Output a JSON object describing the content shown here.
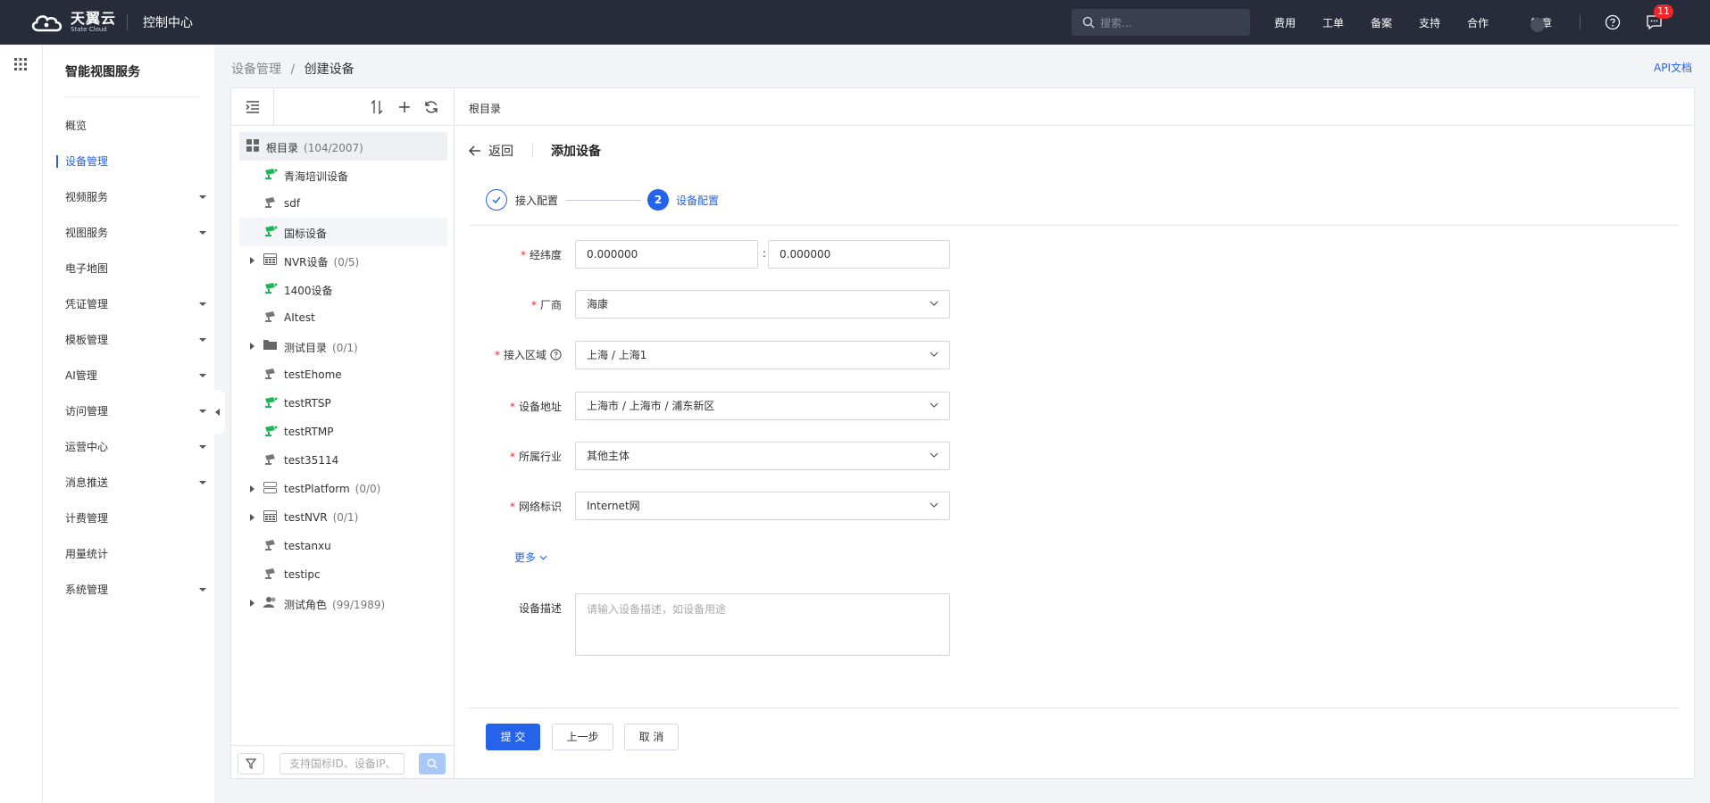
{
  "topbar": {
    "brand_cn": "天翼云",
    "brand_en": "State Cloud",
    "console": "控制中心",
    "search_placeholder": "搜索...",
    "nav": [
      "费用",
      "工单",
      "备案",
      "支持",
      "合作"
    ],
    "user_label": "简章",
    "notification_count": "11"
  },
  "sidebar": {
    "title": "智能视图服务",
    "items": [
      {
        "label": "概览",
        "dropdown": false
      },
      {
        "label": "设备管理",
        "dropdown": false,
        "active": true
      },
      {
        "label": "视频服务",
        "dropdown": true
      },
      {
        "label": "视图服务",
        "dropdown": true
      },
      {
        "label": "电子地图",
        "dropdown": false
      },
      {
        "label": "凭证管理",
        "dropdown": true
      },
      {
        "label": "模板管理",
        "dropdown": true
      },
      {
        "label": "AI管理",
        "dropdown": true
      },
      {
        "label": "访问管理",
        "dropdown": true
      },
      {
        "label": "运营中心",
        "dropdown": true
      },
      {
        "label": "消息推送",
        "dropdown": true
      },
      {
        "label": "计费管理",
        "dropdown": false
      },
      {
        "label": "用量统计",
        "dropdown": false
      },
      {
        "label": "系统管理",
        "dropdown": true
      }
    ]
  },
  "breadcrumb": {
    "parent": "设备管理",
    "separator": "/",
    "current": "创建设备"
  },
  "api_doc": "API文档",
  "tree": {
    "root": {
      "label": "根目录",
      "count": "(104/2007)"
    },
    "items": [
      {
        "label": "青海培训设备",
        "icon": "camera-online",
        "count": ""
      },
      {
        "label": "sdf",
        "icon": "camera-offline",
        "count": ""
      },
      {
        "label": "国标设备",
        "icon": "camera-online",
        "count": "",
        "selected": true
      },
      {
        "label": "NVR设备",
        "icon": "nvr",
        "count": "(0/5)",
        "expandable": true
      },
      {
        "label": "1400设备",
        "icon": "camera-online",
        "count": ""
      },
      {
        "label": "AItest",
        "icon": "camera-offline",
        "count": ""
      },
      {
        "label": "测试目录",
        "icon": "folder",
        "count": "(0/1)",
        "expandable": true
      },
      {
        "label": "testEhome",
        "icon": "camera-offline",
        "count": ""
      },
      {
        "label": "testRTSP",
        "icon": "camera-online",
        "count": ""
      },
      {
        "label": "testRTMP",
        "icon": "camera-online",
        "count": ""
      },
      {
        "label": "test35114",
        "icon": "camera-offline",
        "count": ""
      },
      {
        "label": "testPlatform",
        "icon": "platform",
        "count": "(0/0)",
        "expandable": true
      },
      {
        "label": "testNVR",
        "icon": "nvr",
        "count": "(0/1)",
        "expandable": true
      },
      {
        "label": "testanxu",
        "icon": "camera-offline",
        "count": ""
      },
      {
        "label": "testipc",
        "icon": "camera-offline",
        "count": ""
      },
      {
        "label": "测试角色",
        "icon": "user-group",
        "count": "(99/1989)",
        "expandable": true
      }
    ],
    "search_placeholder": "支持国标ID、设备IP、"
  },
  "main": {
    "path": "根目录",
    "back_label": "返回",
    "title": "添加设备",
    "steps": [
      {
        "label": "接入配置",
        "state": "done"
      },
      {
        "number": "2",
        "label": "设备配置",
        "state": "active"
      }
    ],
    "form": {
      "lnglat": {
        "label": "经纬度",
        "lng": "0.000000",
        "lat": "0.000000",
        "separator": ":"
      },
      "vendor": {
        "label": "厂商",
        "value": "海康"
      },
      "region": {
        "label": "接入区域",
        "value": "上海 / 上海1"
      },
      "address": {
        "label": "设备地址",
        "value": "上海市 / 上海市 / 浦东新区"
      },
      "industry": {
        "label": "所属行业",
        "value": "其他主体"
      },
      "network": {
        "label": "网络标识",
        "value": "Internet网"
      },
      "more": "更多",
      "desc": {
        "label": "设备描述",
        "placeholder": "请输入设备描述，如设备用途"
      }
    },
    "buttons": {
      "submit": "提 交",
      "prev": "上一步",
      "cancel": "取 消"
    }
  },
  "colors": {
    "primary": "#2563eb",
    "topbar": "#272b3a",
    "online": "#21b35b",
    "required": "#f0262a"
  }
}
